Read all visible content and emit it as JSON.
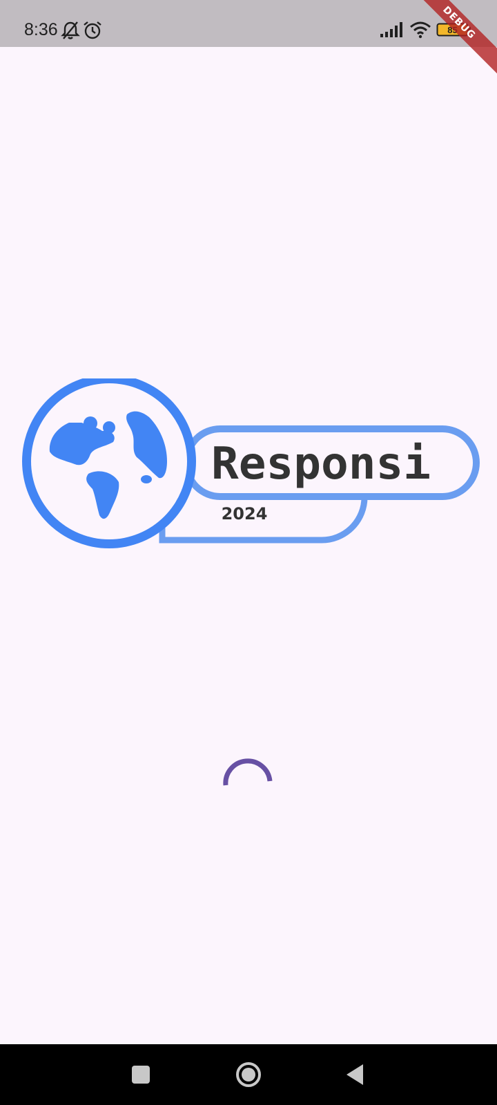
{
  "status_bar": {
    "time": "8:36",
    "battery_level": "85",
    "icons": [
      "bell-off-icon",
      "alarm-icon",
      "signal-icon",
      "wifi-icon",
      "battery-icon"
    ],
    "background_color": "#c1bcc1"
  },
  "debug_banner": {
    "label": "DEBUG",
    "color": "#b22222"
  },
  "splash": {
    "logo_title": "Responsi",
    "logo_year": "2024",
    "logo_accent_color": "#4285f4",
    "logo_pill_color": "#6a9df0",
    "logo_text_color": "#333333",
    "spinner_color": "#6750a4",
    "background_color": "#fcf5fd"
  },
  "navigation_bar": {
    "buttons": [
      "recents-button",
      "home-button",
      "back-button"
    ]
  }
}
